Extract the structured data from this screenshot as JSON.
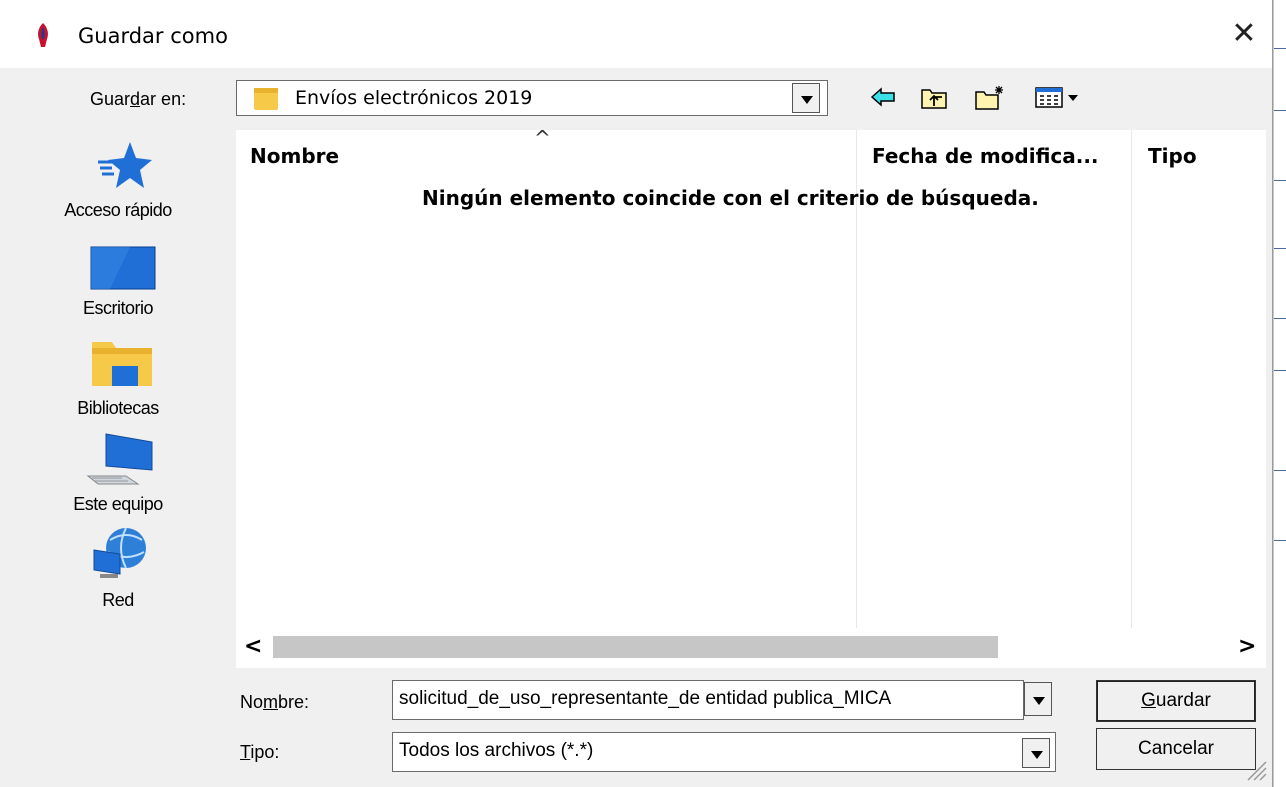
{
  "window": {
    "title": "Guardar como",
    "close_glyph": "✕"
  },
  "location": {
    "label_pre": "Guar",
    "label_key": "d",
    "label_post": "ar en:",
    "value": "Envíos electrónicos 2019"
  },
  "toolbar": {
    "icons": [
      "back-icon",
      "up-folder-icon",
      "new-folder-icon",
      "view-menu-icon"
    ]
  },
  "sidebar": {
    "items": [
      {
        "label": "Acceso rápido",
        "icon": "star-icon"
      },
      {
        "label": "Escritorio",
        "icon": "desktop-icon"
      },
      {
        "label": "Bibliotecas",
        "icon": "libraries-icon"
      },
      {
        "label": "Este equipo",
        "icon": "computer-icon"
      },
      {
        "label": "Red",
        "icon": "network-icon"
      }
    ]
  },
  "file_list": {
    "columns": [
      "Nombre",
      "Fecha de modifica...",
      "Tipo"
    ],
    "sort_glyph": "^",
    "empty_message": "Ningún elemento coincide con el criterio de búsqueda."
  },
  "scrollbar": {
    "left": "<",
    "right": ">"
  },
  "filename": {
    "label_pre": "No",
    "label_key": "m",
    "label_post": "bre:",
    "value": "solicitud_de_uso_representante_de entidad publica_MICA"
  },
  "filetype": {
    "label_key": "T",
    "label_post": "ipo:",
    "value": "Todos los archivos (*.*)"
  },
  "buttons": {
    "save_key": "G",
    "save_rest": "uardar",
    "cancel": "Cancelar"
  },
  "colors": {
    "accent_blue": "#1f6fd6",
    "folder_yellow": "#f7c948"
  }
}
